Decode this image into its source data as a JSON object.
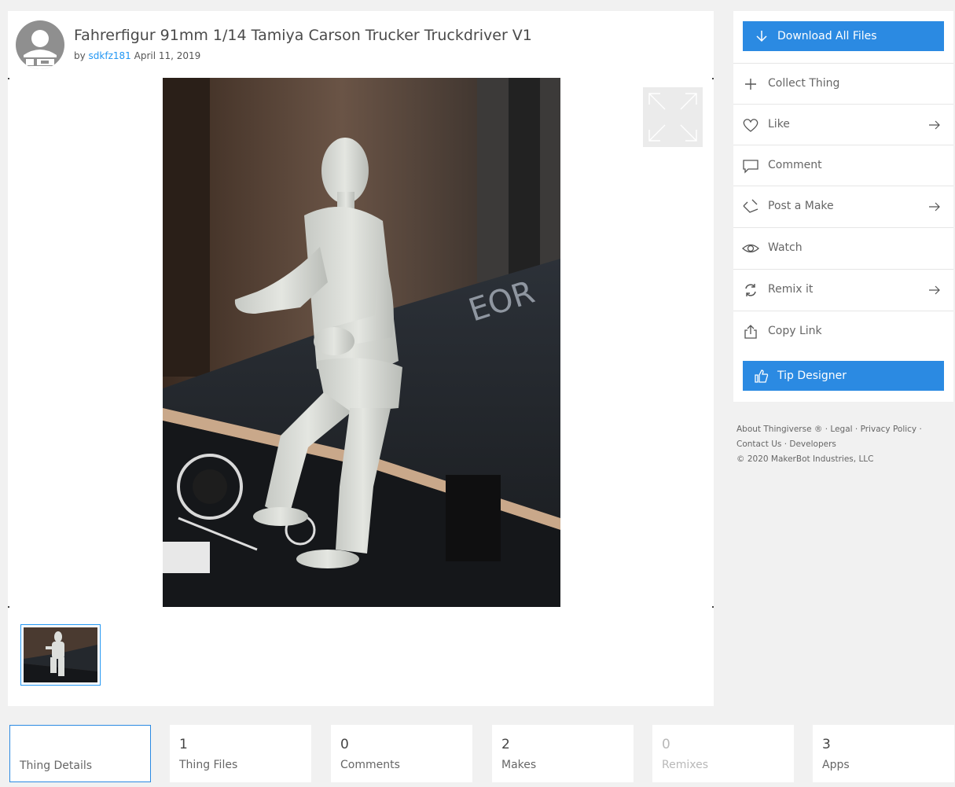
{
  "thing": {
    "title": "Fahrerfigur 91mm 1/14 Tamiya Carson Trucker Truckdriver V1",
    "by": "by",
    "author": "sdkfz181",
    "date": "April 11, 2019"
  },
  "sidebar": {
    "download_label": "Download All Files",
    "tip_label": "Tip Designer",
    "actions": [
      {
        "label": "Collect Thing",
        "icon": "plus-icon",
        "has_arrow": false
      },
      {
        "label": "Like",
        "icon": "heart-icon",
        "has_arrow": true
      },
      {
        "label": "Comment",
        "icon": "comment-icon",
        "has_arrow": false
      },
      {
        "label": "Post a Make",
        "icon": "make-icon",
        "has_arrow": true
      },
      {
        "label": "Watch",
        "icon": "eye-icon",
        "has_arrow": false
      },
      {
        "label": "Remix it",
        "icon": "remix-icon",
        "has_arrow": true
      },
      {
        "label": "Copy Link",
        "icon": "share-icon",
        "has_arrow": false
      }
    ]
  },
  "footer": {
    "about": "About Thingiverse ®",
    "legal": "Legal",
    "privacy": "Privacy Policy",
    "contact": "Contact Us",
    "developers": "Developers",
    "copyright": "© 2020 MakerBot Industries, LLC",
    "sep": "·"
  },
  "tabs": [
    {
      "count": "",
      "label": "Thing Details",
      "active": true,
      "disabled": false
    },
    {
      "count": "1",
      "label": "Thing Files",
      "active": false,
      "disabled": false
    },
    {
      "count": "0",
      "label": "Comments",
      "active": false,
      "disabled": false
    },
    {
      "count": "2",
      "label": "Makes",
      "active": false,
      "disabled": false
    },
    {
      "count": "0",
      "label": "Remixes",
      "active": false,
      "disabled": true
    },
    {
      "count": "3",
      "label": "Apps",
      "active": false,
      "disabled": false
    }
  ],
  "colors": {
    "accent": "#2b8ae2",
    "link": "#2196f3",
    "background": "#f1f1f1"
  }
}
